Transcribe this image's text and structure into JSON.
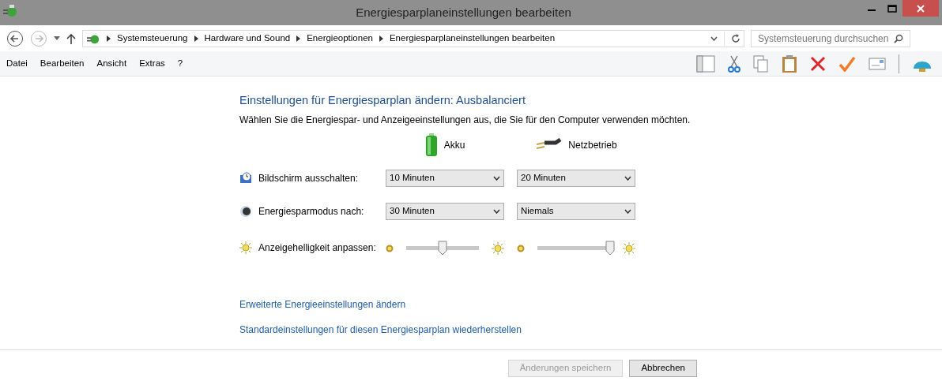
{
  "window": {
    "title": "Energiesparplaneinstellungen bearbeiten"
  },
  "address_bar": {
    "breadcrumbs": [
      "Systemsteuerung",
      "Hardware und Sound",
      "Energieoptionen",
      "Energiesparplaneinstellungen bearbeiten"
    ]
  },
  "search": {
    "placeholder": "Systemsteuerung durchsuchen"
  },
  "menu": [
    "Datei",
    "Bearbeiten",
    "Ansicht",
    "Extras",
    "?"
  ],
  "heading": "Einstellungen für Energiesparplan ändern: Ausbalanciert",
  "description": "Wählen Sie die Energiespar- und Anzeigeeinstellungen aus, die Sie für den Computer verwenden möchten.",
  "columns": [
    "Akku",
    "Netzbetrieb"
  ],
  "settings": [
    {
      "kind": "dropdown",
      "label": "Bildschirm ausschalten:",
      "values": [
        "10 Minuten",
        "20 Minuten"
      ]
    },
    {
      "kind": "dropdown",
      "label": "Energiesparmodus nach:",
      "values": [
        "30 Minuten",
        "Niemals"
      ]
    },
    {
      "kind": "slider",
      "label": "Anzeigehelligkeit anpassen:",
      "sliders": [
        {
          "level": 0.5
        },
        {
          "level": 1
        }
      ]
    }
  ],
  "links": [
    "Erweiterte Energieeinstellungen ändern",
    "Standardeinstellungen für diesen Energiesparplan wiederherstellen"
  ],
  "buttons": [
    {
      "label": "Änderungen speichern",
      "disabled": true
    },
    {
      "label": "Abbrechen",
      "disabled": false
    }
  ]
}
